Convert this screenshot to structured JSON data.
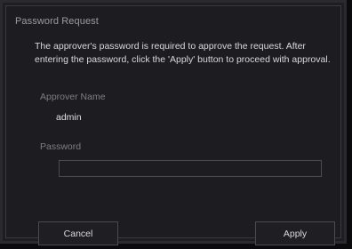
{
  "dialog": {
    "title": "Password Request",
    "description": "The approver's password is required to approve the request. After entering the password, click the 'Apply' button to proceed with approval.",
    "approver_label": "Approver Name",
    "approver_value": "admin",
    "password_label": "Password",
    "password_value": "",
    "cancel_label": "Cancel",
    "apply_label": "Apply"
  }
}
